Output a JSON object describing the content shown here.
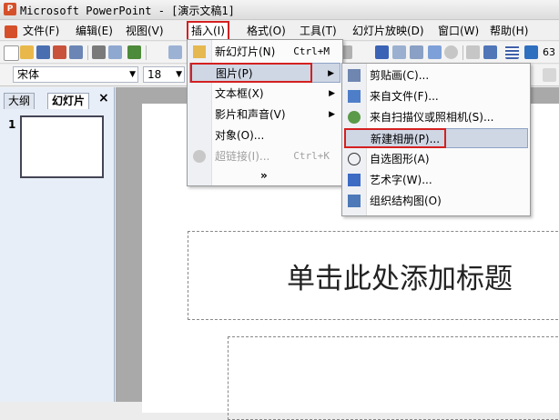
{
  "window": {
    "title": "Microsoft PowerPoint - [演示文稿1]",
    "logo": "P"
  },
  "menubar": {
    "items": [
      {
        "label": "文件(F)"
      },
      {
        "label": "编辑(E)"
      },
      {
        "label": "视图(V)"
      },
      {
        "label": "插入(I)"
      },
      {
        "label": "格式(O)"
      },
      {
        "label": "工具(T)"
      },
      {
        "label": "幻灯片放映(D)"
      },
      {
        "label": "窗口(W)"
      },
      {
        "label": "帮助(H)"
      }
    ]
  },
  "format_toolbar": {
    "font": "宋体",
    "size": "18",
    "zoom": "63"
  },
  "left_pane": {
    "tabs": [
      {
        "label": "大纲"
      },
      {
        "label": "幻灯片"
      }
    ],
    "close": "×",
    "slide_number": "1"
  },
  "insert_menu": {
    "items": [
      {
        "label": "新幻灯片(N)",
        "shortcut": "Ctrl+M"
      },
      {
        "label": "图片(P)",
        "submenu": "▶"
      },
      {
        "label": "文本框(X)",
        "submenu": "▶"
      },
      {
        "label": "影片和声音(V)",
        "submenu": "▶"
      },
      {
        "label": "对象(O)..."
      },
      {
        "label": "超链接(I)...",
        "shortcut": "Ctrl+K"
      }
    ],
    "expand": "»"
  },
  "picture_submenu": {
    "items": [
      {
        "label": "剪贴画(C)..."
      },
      {
        "label": "来自文件(F)..."
      },
      {
        "label": "来自扫描仪或照相机(S)..."
      },
      {
        "label": "新建相册(P)..."
      },
      {
        "label": "自选图形(A)"
      },
      {
        "label": "艺术字(W)..."
      },
      {
        "label": "组织结构图(O)"
      }
    ]
  },
  "slide": {
    "title_placeholder": "单击此处添加标题"
  },
  "colors": {
    "highlight": "#cfd6e4",
    "red_outline": "#d42020"
  }
}
